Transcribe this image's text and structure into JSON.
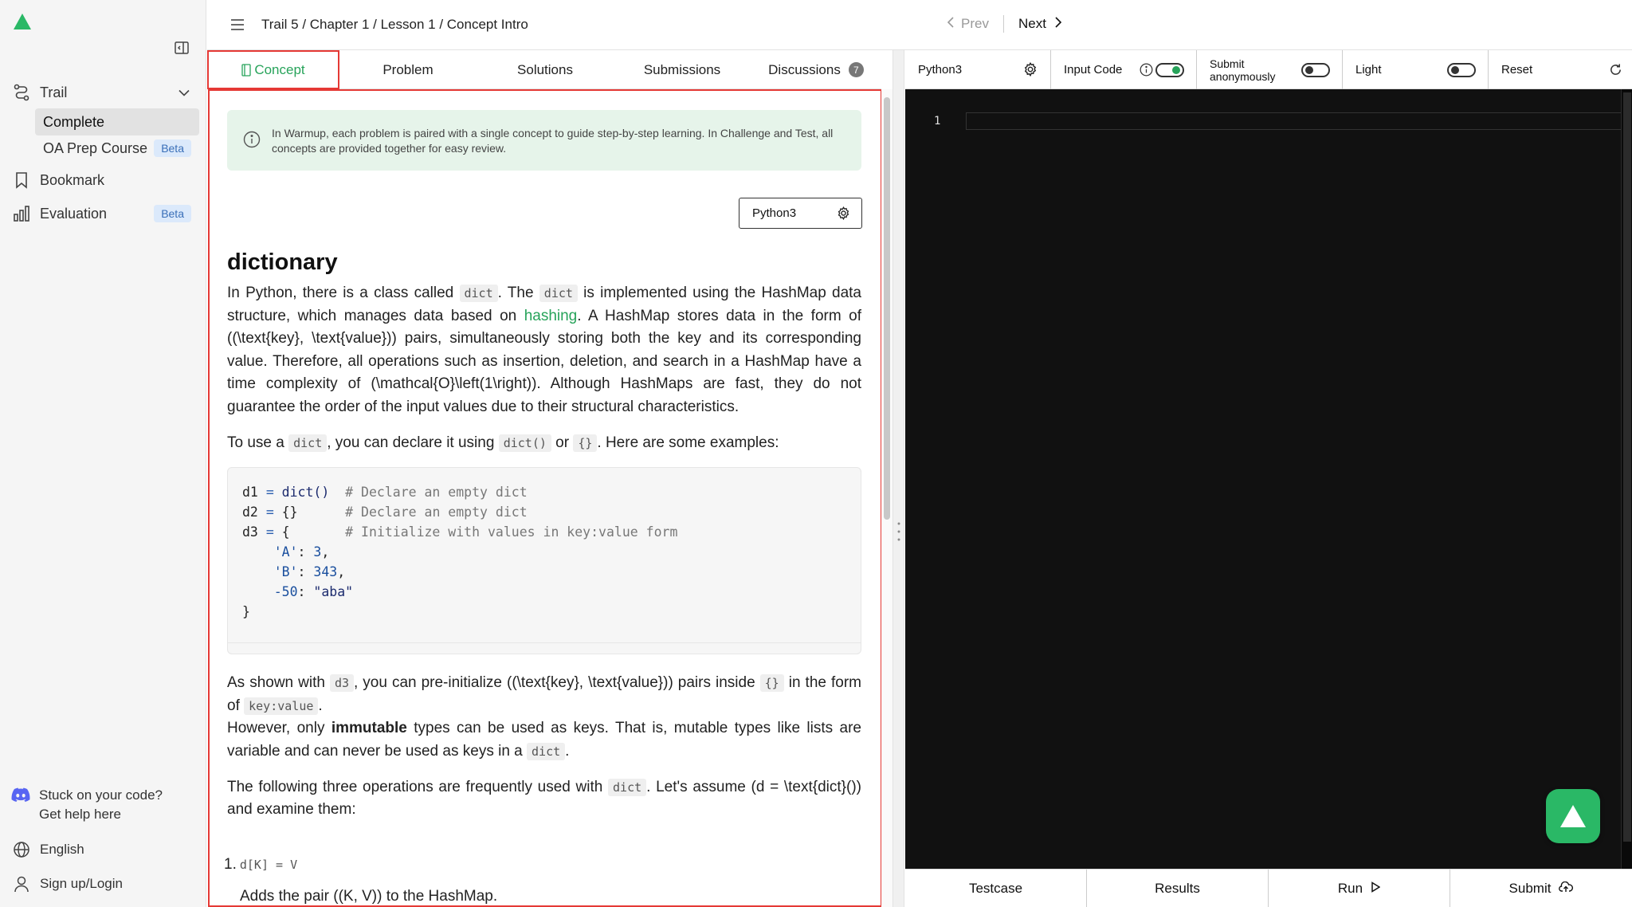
{
  "sidebar": {
    "nav": [
      {
        "label": "Trail",
        "icon": "trail-icon"
      },
      {
        "label": "Bookmark",
        "icon": "bookmark-icon"
      },
      {
        "label": "Evaluation",
        "icon": "bar-chart-icon",
        "badge": "Beta"
      }
    ],
    "trail_items": [
      {
        "label": "Complete"
      },
      {
        "label": "OA Prep Course",
        "badge": "Beta"
      }
    ],
    "help": {
      "line1": "Stuck on your code?",
      "line2": "Get help here"
    },
    "language": "English",
    "login": "Sign up/Login"
  },
  "topbar": {
    "breadcrumb": "Trail 5 / Chapter 1 / Lesson 1 / Concept Intro",
    "prev": "Prev",
    "next": "Next"
  },
  "tabs": [
    {
      "label": "Concept"
    },
    {
      "label": "Problem"
    },
    {
      "label": "Solutions"
    },
    {
      "label": "Submissions"
    },
    {
      "label": "Discussions",
      "count": "7"
    }
  ],
  "notice": "In Warmup, each problem is paired with a single concept to guide step-by-step learning. In Challenge and Test, all concepts are provided together for easy review.",
  "language_select": "Python3",
  "doc": {
    "title": "dictionary",
    "p1": {
      "a": "In Python, there is a class called ",
      "code1": "dict",
      "b": ". The ",
      "code2": "dict",
      "c": " is implemented using the HashMap data structure, which manages data based on ",
      "link": "hashing",
      "d": ". A HashMap stores data in the form of ((\\text{key}, \\text{value})) pairs, simultaneously storing both the key and its corresponding value. Therefore, all operations such as insertion, deletion, and search in a HashMap have a time complexity of (\\mathcal{O}\\left(1\\right)). Although HashMaps are fast, they do not guarantee the order of the input values due to their structural characteristics."
    },
    "p2": {
      "a": "To use a ",
      "code1": "dict",
      "b": ", you can declare it using ",
      "code2": "dict()",
      "c": " or ",
      "code3": "{}",
      "d": ". Here are some examples:"
    },
    "code_lines": {
      "l1a": "d1 ",
      "l1op": "=",
      "l1fn": " dict()",
      "l1cm": "  # Declare an empty dict",
      "l2a": "d2 ",
      "l2op": "=",
      "l2b": " {}",
      "l2cm": "      # Declare an empty dict",
      "l3a": "d3 ",
      "l3op": "=",
      "l3b": " {",
      "l3cm": "       # Initialize with values in key:value form",
      "l4k": "    'A'",
      "l4c": ": ",
      "l4v": "3",
      "l4e": ",",
      "l5k": "    'B'",
      "l5c": ": ",
      "l5v": "343",
      "l5e": ",",
      "l6k": "    -50",
      "l6c": ": ",
      "l6v": "\"aba\"",
      "l7": "}"
    },
    "p3": {
      "a": "As shown with ",
      "code1": "d3",
      "b": ", you can pre-initialize ((\\text{key}, \\text{value})) pairs inside ",
      "code2": "{}",
      "c": " in the form of ",
      "code3": "key:value",
      "d": "."
    },
    "p4": {
      "a": "However, only ",
      "strong": "immutable",
      "b": " types can be used as keys. That is, mutable types like lists are variable and can never be used as keys in a ",
      "code1": "dict",
      "c": "."
    },
    "p5": {
      "a": "The following three operations are frequently used with ",
      "code1": "dict",
      "b": ". Let's assume (d = \\text{dict}()) and examine them:"
    },
    "ol": {
      "num": "1.",
      "code": "d[K] = V",
      "desc": "Adds the pair ((K, V)) to the HashMap."
    }
  },
  "editor": {
    "language": "Python3",
    "input_code": "Input Code",
    "submit_anon_1": "Submit",
    "submit_anon_2": "anonymously",
    "theme": "Light",
    "reset": "Reset",
    "line_number": "1",
    "input_code_on": true,
    "submit_anon_on": false,
    "light_on": false
  },
  "bottom": {
    "testcase": "Testcase",
    "results": "Results",
    "run": "Run",
    "submit": "Submit"
  },
  "colors": {
    "accent": "#27a35a",
    "highlight_border": "#e53935",
    "editor_bg": "#111111"
  }
}
